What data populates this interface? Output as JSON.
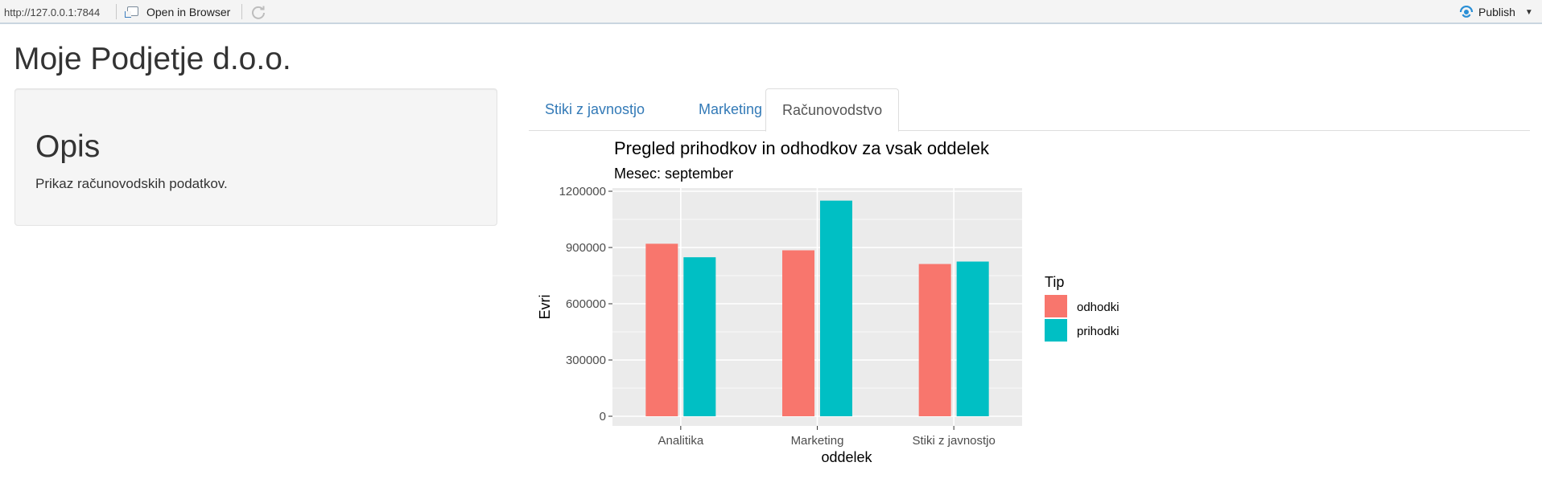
{
  "viewer": {
    "url": "http://127.0.0.1:7844",
    "open_in_browser": "Open in Browser",
    "publish": "Publish"
  },
  "app": {
    "title": "Moje Podjetje d.o.o."
  },
  "sidebar": {
    "heading": "Opis",
    "description": "Prikaz računovodskih podatkov."
  },
  "tabs": [
    {
      "label": "Stiki z javnostjo",
      "active": false
    },
    {
      "label": "Marketing",
      "active": false
    },
    {
      "label": "Računovodstvo",
      "active": true
    }
  ],
  "colors": {
    "odhodki": "#F8766D",
    "prihodki": "#00BFC4",
    "panel": "#EBEBEB",
    "link": "#337ab7"
  },
  "chart_data": {
    "type": "bar",
    "title": "Pregled prihodkov in odhodkov za vsak oddelek",
    "subtitle": "Mesec: september",
    "xlabel": "oddelek",
    "ylabel": "Evri",
    "categories": [
      "Analitika",
      "Marketing",
      "Stiki z javnostjo"
    ],
    "series": [
      {
        "name": "odhodki",
        "values": [
          920000,
          885000,
          812000
        ]
      },
      {
        "name": "prihodki",
        "values": [
          848000,
          1150000,
          825000
        ]
      }
    ],
    "ylim": [
      0,
      1200000
    ],
    "yticks": [
      0,
      300000,
      600000,
      900000,
      1200000
    ],
    "legend_title": "Tip",
    "legend_position": "right",
    "grid": true
  }
}
